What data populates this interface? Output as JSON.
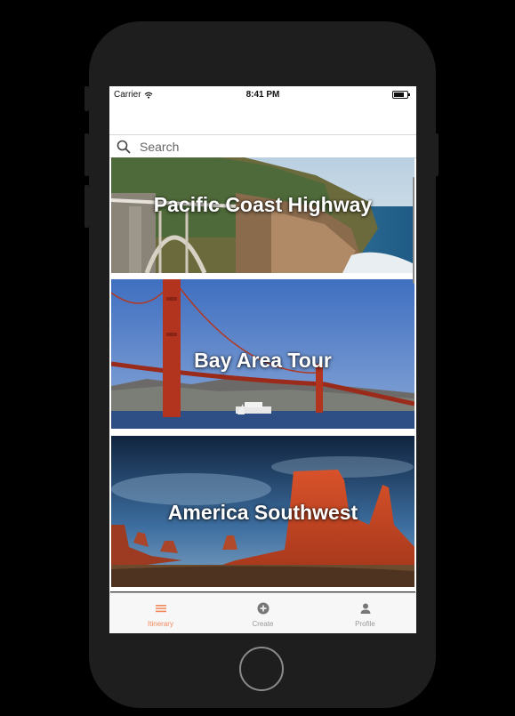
{
  "status_bar": {
    "carrier": "Carrier",
    "time": "8:41 PM"
  },
  "search": {
    "placeholder": "Search",
    "value": ""
  },
  "cards": [
    {
      "title": "Pacific Coast Highway"
    },
    {
      "title": "Bay Area Tour"
    },
    {
      "title": "America Southwest"
    }
  ],
  "tab_bar": {
    "items": [
      {
        "label": "Itinerary",
        "icon": "list-icon",
        "active": true
      },
      {
        "label": "Create",
        "icon": "plus-circle-icon",
        "active": false
      },
      {
        "label": "Profile",
        "icon": "person-icon",
        "active": false
      }
    ]
  },
  "colors": {
    "accent": "#f08a5d",
    "phone_body": "#1e1e1e"
  }
}
